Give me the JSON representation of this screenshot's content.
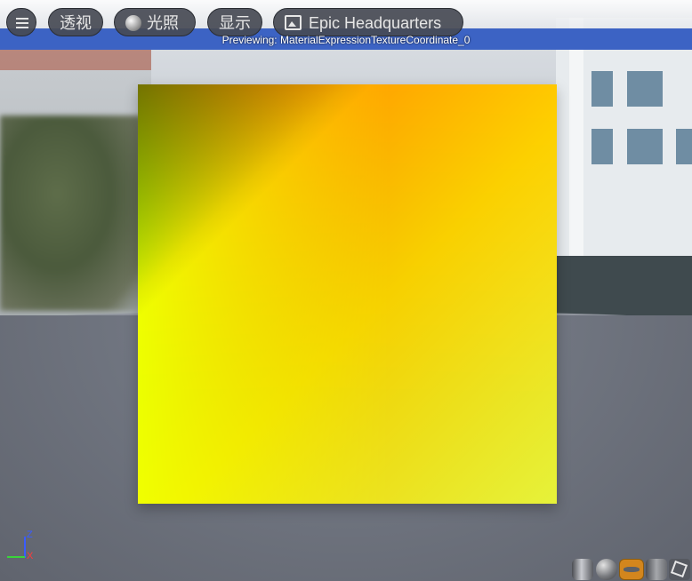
{
  "toolbar": {
    "perspective_label": "透视",
    "lighting_label": "光照",
    "show_label": "显示",
    "environment_label": "Epic Headquarters"
  },
  "preview_status": "Previewing: MaterialExpressionTextureCoordinate_0",
  "axis_gizmo": {
    "z_label": "Z",
    "x_label": "X"
  },
  "preview_shapes": [
    "cylinder",
    "sphere",
    "plane",
    "cube",
    "custom-mesh"
  ],
  "selected_shape": "plane",
  "colors": {
    "toolbar_band": "#3c63c4",
    "selected_shape": "#d3861d"
  }
}
